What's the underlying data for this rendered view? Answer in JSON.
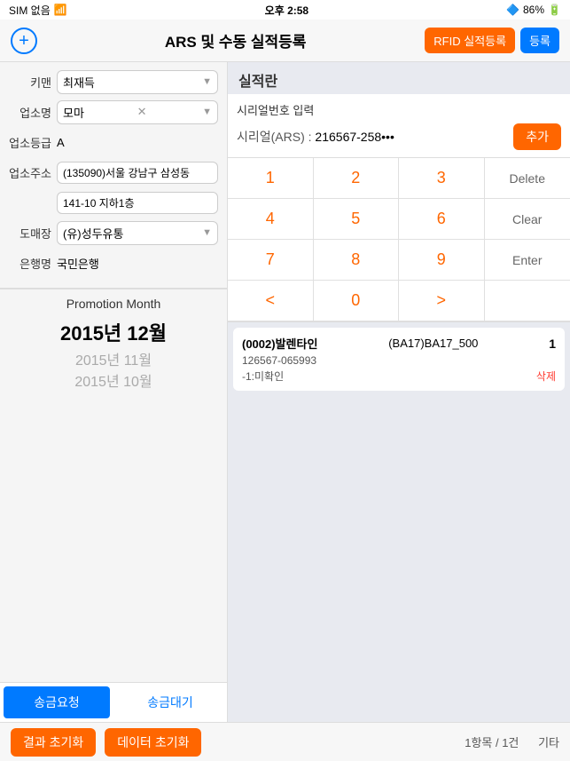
{
  "statusBar": {
    "carrier": "SIM 없음",
    "wifi": "wifi-icon",
    "time": "오후 2:58",
    "bluetooth": "bluetooth-icon",
    "battery": "86%"
  },
  "header": {
    "addButton": "+",
    "title": "ARS 및 수동 실적등록",
    "rfidButton": "RFID 실적등록",
    "registerButton": "등록"
  },
  "leftPanel": {
    "fields": [
      {
        "label": "키맨",
        "value": "최재득",
        "type": "select"
      },
      {
        "label": "업소명",
        "value": "모마",
        "type": "select-x"
      },
      {
        "label": "업소등급",
        "value": "A",
        "type": "text"
      },
      {
        "label": "업소주소",
        "value": "(135090)서울 강남구 삼성동",
        "value2": "141-10  지하1층",
        "type": "address"
      },
      {
        "label": "도매장",
        "value": "(유)성두유통",
        "type": "select"
      },
      {
        "label": "은행명",
        "value": "국민은행",
        "type": "text"
      }
    ],
    "promotionMonth": {
      "label": "Promotion Month",
      "months": [
        {
          "text": "2015년 12월",
          "primary": true
        },
        {
          "text": "2015년 11월",
          "primary": false
        },
        {
          "text": "2015년 10월",
          "primary": false
        }
      ]
    },
    "tabs": [
      {
        "label": "송금요청",
        "active": true
      },
      {
        "label": "송금대기",
        "active": false
      }
    ]
  },
  "rightPanel": {
    "title": "실적란",
    "serial": {
      "inputLabel": "시리얼번호 입력",
      "serialLabel": "시리얼(ARS) :",
      "serialValue": "216567-258•••",
      "addButton": "추가"
    },
    "numpad": {
      "keys": [
        "1",
        "2",
        "3",
        "Delete",
        "4",
        "5",
        "6",
        "Clear",
        "7",
        "8",
        "9",
        "Enter",
        "<",
        "0",
        ">",
        ""
      ]
    },
    "results": [
      {
        "name": "(0002)발렌타인",
        "code": "(BA17)BA17_500",
        "count": "1",
        "serial": "126567-065993",
        "status": "-1:미확인",
        "deleteLabel": "삭제"
      }
    ],
    "footer": {
      "resetLabel": "결과 초기화",
      "dataResetLabel": "데이터 초기화",
      "summary": "1항목 / 1건",
      "category": "기타"
    }
  }
}
